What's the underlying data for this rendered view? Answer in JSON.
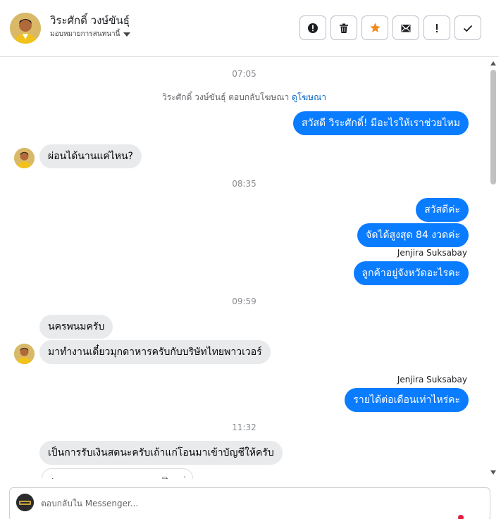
{
  "header": {
    "contact_name": "วิระศักดิ์ วงษ์ขันธุ์",
    "assign_label": "มอบหมายการสนทนานี้"
  },
  "toolbar": {
    "buttons": [
      "alert-circle-icon",
      "trash-icon",
      "star-icon",
      "mark-unread-icon",
      "important-icon",
      "check-icon"
    ],
    "star_color": "#f38b1a"
  },
  "thread": {
    "timestamps": [
      "07:05",
      "08:35",
      "09:59",
      "11:32"
    ],
    "ad_notice": "วิระศักดิ์ วงษ์ขันธุ์ ตอบกลับโฆษณา",
    "ad_link": "ดูโฆษณา",
    "messages": [
      {
        "dir": "out",
        "text": "สวัสดี วิระศักดิ์! มีอะไรให้เราช่วยไหม"
      },
      {
        "dir": "in",
        "text": "ผ่อนได้นานแค่ไหน?"
      },
      {
        "dir": "out",
        "text": "สวัสดีค่ะ"
      },
      {
        "dir": "out",
        "text": "จัดได้สูงสุด 84 งวดค่ะ"
      },
      {
        "dir": "out",
        "text": "ลูกค้าอยู่จังหวัดอะไรคะ"
      },
      {
        "dir": "in",
        "text": "นครพนมครับ"
      },
      {
        "dir": "in",
        "text": "มาทำงานเดี๋ยวมุกดาหารครับกับบริษัทไทยพาวเวอร์"
      },
      {
        "dir": "out",
        "text": "รายได้ต่อเดือนเท่าไหร่คะ"
      },
      {
        "dir": "in",
        "text": "เป็นการรับเงินสดนะครับเถ้าแก่โอนมาเข้าบัญชีให้ครับ"
      }
    ],
    "sender_names": [
      "Jenjira Suksabay",
      "Jenjira Suksabay"
    ]
  },
  "composer": {
    "placeholder": "ตอบกลับใน Messenger..."
  },
  "colors": {
    "outgoing_bubble": "#0a7cff",
    "incoming_bubble": "#e9eaec",
    "link": "#0a66c2"
  }
}
